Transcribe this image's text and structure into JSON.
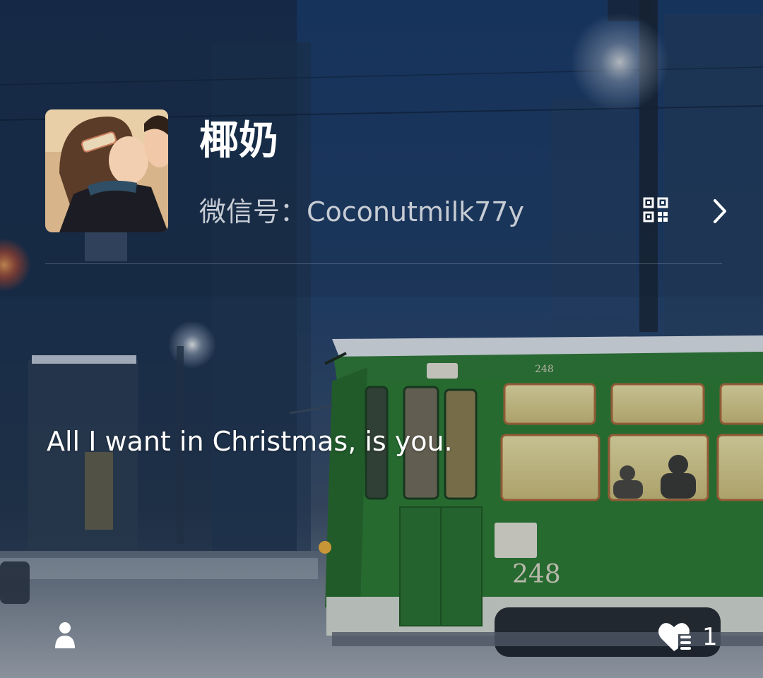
{
  "profile": {
    "nickname": "椰奶",
    "wechat_id": "微信号：Coconutmilk77y"
  },
  "status": {
    "text": "All I want in Christmas, is you."
  },
  "footer": {
    "like_count": "1"
  },
  "icons": {
    "qr": "qr-code-icon",
    "arrow": "chevron-right-icon",
    "person": "person-icon",
    "like": "heart-list-icon"
  },
  "colors": {
    "tram_green": "#2e7d32",
    "sky_blue": "#1f3f6e",
    "text_primary": "#ffffff",
    "text_secondary": "#c7ccd4"
  }
}
